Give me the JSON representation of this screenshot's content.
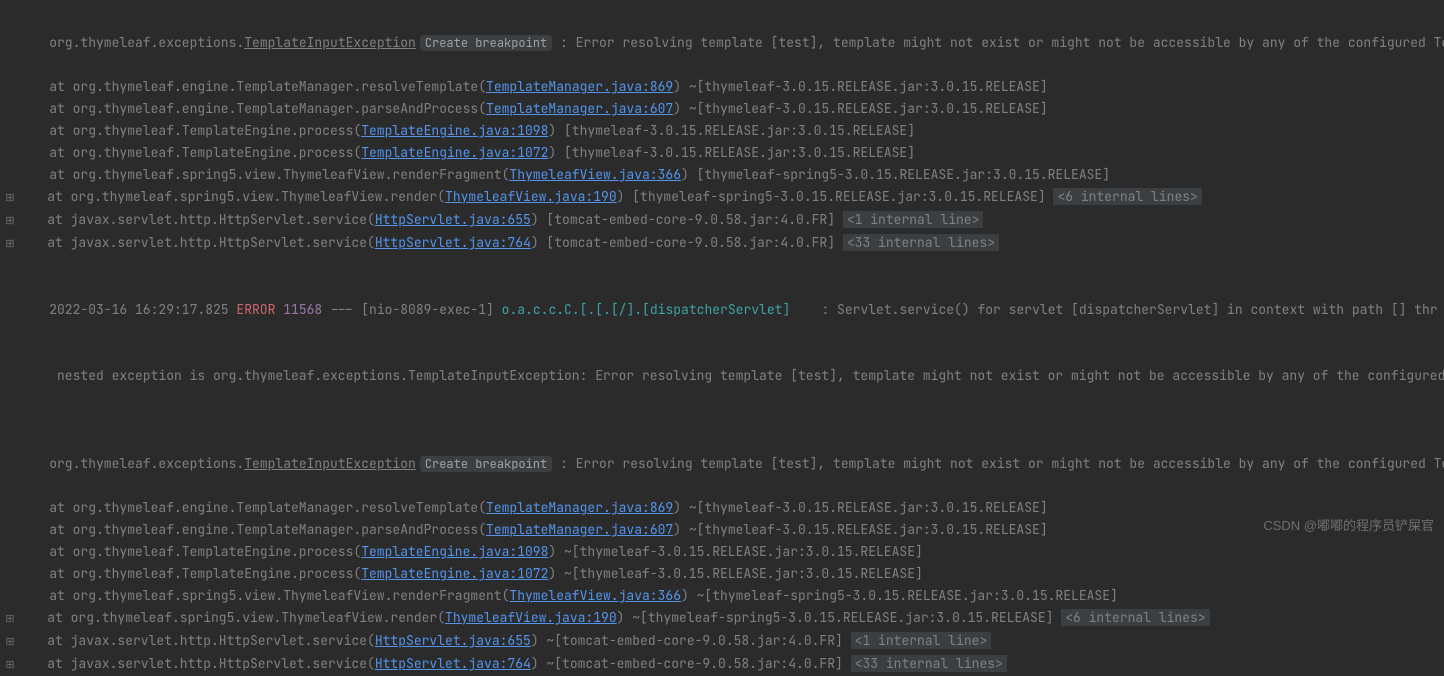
{
  "watermark": "CSDN @嘟嘟的程序员铲屎官",
  "create_breakpoint_label": "Create breakpoint",
  "gutter_expand": "⊞",
  "block1": {
    "exception_pkg": "org.thymeleaf.exceptions.",
    "exception_class": "TemplateInputException",
    "exception_msg": " : Error resolving template [test], template might not exist or might not be accessible by any of the configured Temp",
    "frames": [
      {
        "at": "    at org.thymeleaf.engine.TemplateManager.resolveTemplate(",
        "link": "TemplateManager.java:869",
        "tail": ") ~[thymeleaf-3.0.15.RELEASE.jar:3.0.15.RELEASE]",
        "gutter": false,
        "folded": ""
      },
      {
        "at": "    at org.thymeleaf.engine.TemplateManager.parseAndProcess(",
        "link": "TemplateManager.java:607",
        "tail": ") ~[thymeleaf-3.0.15.RELEASE.jar:3.0.15.RELEASE]",
        "gutter": false,
        "folded": ""
      },
      {
        "at": "    at org.thymeleaf.TemplateEngine.process(",
        "link": "TemplateEngine.java:1098",
        "tail": ") [thymeleaf-3.0.15.RELEASE.jar:3.0.15.RELEASE]",
        "gutter": false,
        "folded": ""
      },
      {
        "at": "    at org.thymeleaf.TemplateEngine.process(",
        "link": "TemplateEngine.java:1072",
        "tail": ") [thymeleaf-3.0.15.RELEASE.jar:3.0.15.RELEASE]",
        "gutter": false,
        "folded": ""
      },
      {
        "at": "    at org.thymeleaf.spring5.view.ThymeleafView.renderFragment(",
        "link": "ThymeleafView.java:366",
        "tail": ") [thymeleaf-spring5-3.0.15.RELEASE.jar:3.0.15.RELEASE]",
        "gutter": false,
        "folded": ""
      },
      {
        "at": "    at org.thymeleaf.spring5.view.ThymeleafView.render(",
        "link": "ThymeleafView.java:190",
        "tail": ") [thymeleaf-spring5-3.0.15.RELEASE.jar:3.0.15.RELEASE] ",
        "gutter": true,
        "folded": "<6 internal lines>"
      },
      {
        "at": "    at javax.servlet.http.HttpServlet.service(",
        "link": "HttpServlet.java:655",
        "tail": ") [tomcat-embed-core-9.0.58.jar:4.0.FR] ",
        "gutter": true,
        "folded": "<1 internal line>"
      },
      {
        "at": "    at javax.servlet.http.HttpServlet.service(",
        "link": "HttpServlet.java:764",
        "tail": ") [tomcat-embed-core-9.0.58.jar:4.0.FR] ",
        "gutter": true,
        "folded": "<33 internal lines>"
      }
    ]
  },
  "logline": {
    "ts": "2022-03-16 16:29:17.825 ",
    "level": "ERROR",
    "pid": " 11568",
    "sep": " --- [nio-8089-exec-1] ",
    "logger": "o.a.c.c.C.[.[.[/].[dispatcherServlet]   ",
    "msg": " : Servlet.service() for servlet [dispatcherServlet] in context with path [] thr",
    "nested": " nested exception is org.thymeleaf.exceptions.TemplateInputException: Error resolving template [test], template might not exist or might not be accessible by any of the configured"
  },
  "block2": {
    "exception_pkg": "org.thymeleaf.exceptions.",
    "exception_class": "TemplateInputException",
    "exception_msg": " : Error resolving template [test], template might not exist or might not be accessible by any of the configured Temp",
    "frames": [
      {
        "at": "    at org.thymeleaf.engine.TemplateManager.resolveTemplate(",
        "link": "TemplateManager.java:869",
        "tail": ") ~[thymeleaf-3.0.15.RELEASE.jar:3.0.15.RELEASE]",
        "gutter": false,
        "folded": ""
      },
      {
        "at": "    at org.thymeleaf.engine.TemplateManager.parseAndProcess(",
        "link": "TemplateManager.java:607",
        "tail": ") ~[thymeleaf-3.0.15.RELEASE.jar:3.0.15.RELEASE]",
        "gutter": false,
        "folded": ""
      },
      {
        "at": "    at org.thymeleaf.TemplateEngine.process(",
        "link": "TemplateEngine.java:1098",
        "tail": ") ~[thymeleaf-3.0.15.RELEASE.jar:3.0.15.RELEASE]",
        "gutter": false,
        "folded": ""
      },
      {
        "at": "    at org.thymeleaf.TemplateEngine.process(",
        "link": "TemplateEngine.java:1072",
        "tail": ") ~[thymeleaf-3.0.15.RELEASE.jar:3.0.15.RELEASE]",
        "gutter": false,
        "folded": ""
      },
      {
        "at": "    at org.thymeleaf.spring5.view.ThymeleafView.renderFragment(",
        "link": "ThymeleafView.java:366",
        "tail": ") ~[thymeleaf-spring5-3.0.15.RELEASE.jar:3.0.15.RELEASE]",
        "gutter": false,
        "folded": ""
      },
      {
        "at": "    at org.thymeleaf.spring5.view.ThymeleafView.render(",
        "link": "ThymeleafView.java:190",
        "tail": ") ~[thymeleaf-spring5-3.0.15.RELEASE.jar:3.0.15.RELEASE] ",
        "gutter": true,
        "folded": "<6 internal lines>"
      },
      {
        "at": "    at javax.servlet.http.HttpServlet.service(",
        "link": "HttpServlet.java:655",
        "tail": ") ~[tomcat-embed-core-9.0.58.jar:4.0.FR] ",
        "gutter": true,
        "folded": "<1 internal line>"
      },
      {
        "at": "    at javax.servlet.http.HttpServlet.service(",
        "link": "HttpServlet.java:764",
        "tail": ") ~[tomcat-embed-core-9.0.58.jar:4.0.FR] ",
        "gutter": true,
        "folded": "<33 internal lines>"
      }
    ]
  }
}
